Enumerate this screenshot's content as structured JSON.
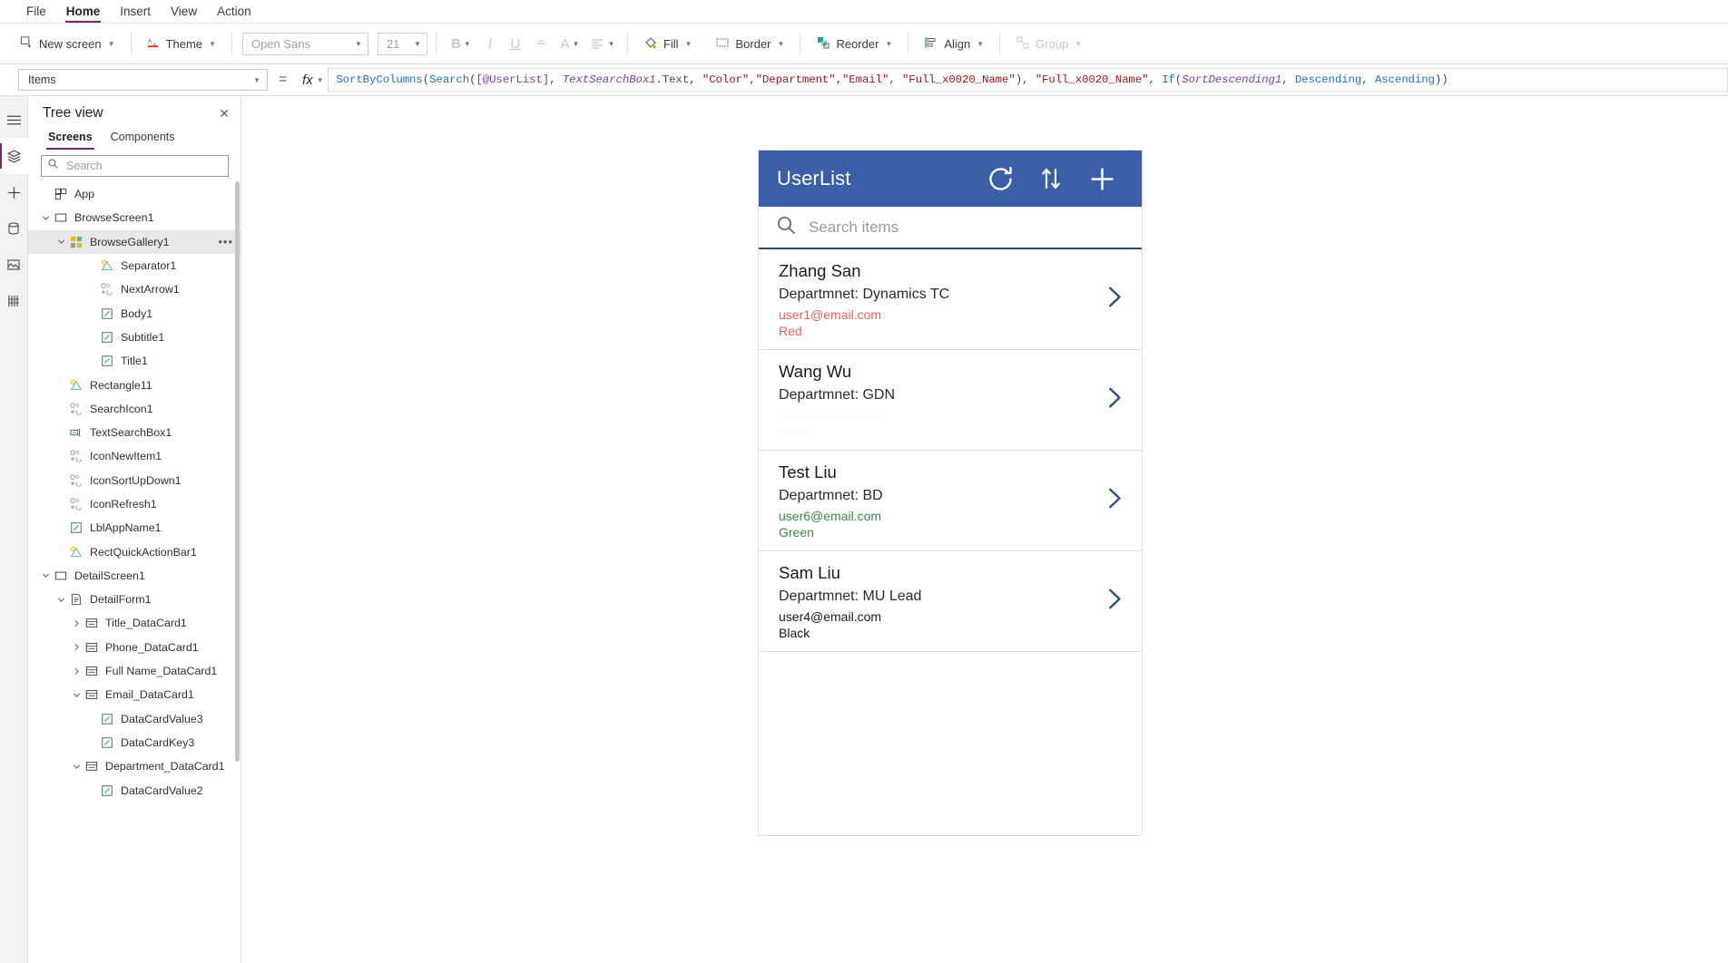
{
  "menubar": {
    "items": [
      {
        "label": "File",
        "active": false
      },
      {
        "label": "Home",
        "active": true
      },
      {
        "label": "Insert",
        "active": false
      },
      {
        "label": "View",
        "active": false
      },
      {
        "label": "Action",
        "active": false
      }
    ]
  },
  "ribbon": {
    "new_screen": "New screen",
    "theme": "Theme",
    "font_family": "Open Sans",
    "font_size": "21",
    "bold": "B",
    "italic": "I",
    "underline": "U",
    "strikethrough": "S",
    "font_color": "A",
    "align": "align",
    "fill": "Fill",
    "border": "Border",
    "reorder": "Reorder",
    "align_group": "Align",
    "group": "Group"
  },
  "formula_bar": {
    "property": "Items",
    "equals": "=",
    "fx": "fx",
    "formula_text": "SortByColumns(Search([@UserList], TextSearchBox1.Text, \"Color\",\"Department\",\"Email\", \"Full_x0020_Name\"), \"Full_x0020_Name\", If(SortDescending1, Descending, Ascending))",
    "tokens": [
      {
        "t": "SortByColumns",
        "c": "tk-fn"
      },
      {
        "t": "(",
        "c": "tk-op"
      },
      {
        "t": "Search",
        "c": "tk-fn"
      },
      {
        "t": "(",
        "c": "tk-op"
      },
      {
        "t": "[@UserList]",
        "c": "tk-tbl"
      },
      {
        "t": ", ",
        "c": "tk-op"
      },
      {
        "t": "TextSearchBox1",
        "c": "tk-id"
      },
      {
        "t": ".Text, ",
        "c": "tk-op"
      },
      {
        "t": "\"Color\"",
        "c": "tk-str"
      },
      {
        "t": ",",
        "c": "tk-op"
      },
      {
        "t": "\"Department\"",
        "c": "tk-str"
      },
      {
        "t": ",",
        "c": "tk-op"
      },
      {
        "t": "\"Email\"",
        "c": "tk-str"
      },
      {
        "t": ", ",
        "c": "tk-op"
      },
      {
        "t": "\"Full_x0020_Name\"",
        "c": "tk-str"
      },
      {
        "t": "), ",
        "c": "tk-op"
      },
      {
        "t": "\"Full_x0020_Name\"",
        "c": "tk-str"
      },
      {
        "t": ", ",
        "c": "tk-op"
      },
      {
        "t": "If",
        "c": "tk-fn"
      },
      {
        "t": "(",
        "c": "tk-op"
      },
      {
        "t": "SortDescending1",
        "c": "tk-id"
      },
      {
        "t": ", ",
        "c": "tk-op"
      },
      {
        "t": "Descending",
        "c": "tk-enum"
      },
      {
        "t": ", ",
        "c": "tk-op"
      },
      {
        "t": "Ascending",
        "c": "tk-enum"
      },
      {
        "t": "))",
        "c": "tk-op"
      }
    ]
  },
  "rail": {
    "items": [
      {
        "name": "hamburger-menu-icon",
        "selected": false
      },
      {
        "name": "tree-view-icon",
        "selected": true
      },
      {
        "name": "insert-plus-icon",
        "selected": false
      },
      {
        "name": "data-sources-icon",
        "selected": false
      },
      {
        "name": "media-icon",
        "selected": false
      },
      {
        "name": "variables-icon",
        "selected": false
      }
    ]
  },
  "tree_view": {
    "title": "Tree view",
    "close_label": "✕",
    "tabs": [
      {
        "label": "Screens",
        "active": true
      },
      {
        "label": "Components",
        "active": false
      }
    ],
    "search_placeholder": "Search",
    "search_value": "",
    "nodes": [
      {
        "label": "App",
        "indent": 0,
        "chev": "",
        "icon": "app-icon",
        "selected": false,
        "dots": false
      },
      {
        "label": "BrowseScreen1",
        "indent": 0,
        "chev": "v",
        "icon": "screen-icon",
        "selected": false,
        "dots": false
      },
      {
        "label": "BrowseGallery1",
        "indent": 1,
        "chev": "v",
        "icon": "gallery-icon",
        "selected": true,
        "dots": true
      },
      {
        "label": "Separator1",
        "indent": 3,
        "chev": "",
        "icon": "shape-icon",
        "selected": false,
        "dots": false
      },
      {
        "label": "NextArrow1",
        "indent": 3,
        "chev": "",
        "icon": "icon-icon",
        "selected": false,
        "dots": false
      },
      {
        "label": "Body1",
        "indent": 3,
        "chev": "",
        "icon": "label-icon",
        "selected": false,
        "dots": false
      },
      {
        "label": "Subtitle1",
        "indent": 3,
        "chev": "",
        "icon": "label-icon",
        "selected": false,
        "dots": false
      },
      {
        "label": "Title1",
        "indent": 3,
        "chev": "",
        "icon": "label-icon",
        "selected": false,
        "dots": false
      },
      {
        "label": "Rectangle11",
        "indent": 1,
        "chev": "",
        "icon": "shape-icon",
        "selected": false,
        "dots": false
      },
      {
        "label": "SearchIcon1",
        "indent": 1,
        "chev": "",
        "icon": "icon-icon",
        "selected": false,
        "dots": false
      },
      {
        "label": "TextSearchBox1",
        "indent": 1,
        "chev": "",
        "icon": "textinput-icon",
        "selected": false,
        "dots": false
      },
      {
        "label": "IconNewItem1",
        "indent": 1,
        "chev": "",
        "icon": "icon-icon",
        "selected": false,
        "dots": false
      },
      {
        "label": "IconSortUpDown1",
        "indent": 1,
        "chev": "",
        "icon": "icon-icon",
        "selected": false,
        "dots": false
      },
      {
        "label": "IconRefresh1",
        "indent": 1,
        "chev": "",
        "icon": "icon-icon",
        "selected": false,
        "dots": false
      },
      {
        "label": "LblAppName1",
        "indent": 1,
        "chev": "",
        "icon": "label-icon",
        "selected": false,
        "dots": false
      },
      {
        "label": "RectQuickActionBar1",
        "indent": 1,
        "chev": "",
        "icon": "shape-icon",
        "selected": false,
        "dots": false
      },
      {
        "label": "DetailScreen1",
        "indent": 0,
        "chev": "v",
        "icon": "screen-icon",
        "selected": false,
        "dots": false
      },
      {
        "label": "DetailForm1",
        "indent": 1,
        "chev": "v",
        "icon": "form-icon",
        "selected": false,
        "dots": false
      },
      {
        "label": "Title_DataCard1",
        "indent": 2,
        "chev": ">",
        "icon": "datacard-icon",
        "selected": false,
        "dots": false
      },
      {
        "label": "Phone_DataCard1",
        "indent": 2,
        "chev": ">",
        "icon": "datacard-icon",
        "selected": false,
        "dots": false
      },
      {
        "label": "Full Name_DataCard1",
        "indent": 2,
        "chev": ">",
        "icon": "datacard-icon",
        "selected": false,
        "dots": false
      },
      {
        "label": "Email_DataCard1",
        "indent": 2,
        "chev": "v",
        "icon": "datacard-icon",
        "selected": false,
        "dots": false
      },
      {
        "label": "DataCardValue3",
        "indent": 3,
        "chev": "",
        "icon": "label-icon",
        "selected": false,
        "dots": false
      },
      {
        "label": "DataCardKey3",
        "indent": 3,
        "chev": "",
        "icon": "label-icon",
        "selected": false,
        "dots": false
      },
      {
        "label": "Department_DataCard1",
        "indent": 2,
        "chev": "v",
        "icon": "datacard-icon",
        "selected": false,
        "dots": false
      },
      {
        "label": "DataCardValue2",
        "indent": 3,
        "chev": "",
        "icon": "label-icon",
        "selected": false,
        "dots": false
      }
    ]
  },
  "app_preview": {
    "header": {
      "title": "UserList",
      "icons": [
        {
          "name": "refresh-icon"
        },
        {
          "name": "sort-updown-icon"
        },
        {
          "name": "add-new-item-icon"
        }
      ],
      "background": "#3a5fa8"
    },
    "search": {
      "placeholder": "Search items",
      "value": "",
      "icon": "search-icon"
    },
    "gallery_items": [
      {
        "title": "Zhang San",
        "subtitle": "Departmnet: Dynamics TC",
        "email": "user1@email.com",
        "color_name": "Red",
        "color_hex": "#e8615a"
      },
      {
        "title": "Wang Wu",
        "subtitle": "Departmnet: GDN",
        "email": "user3@email.com",
        "color_name": "White",
        "color_hex": "#fcfcfc"
      },
      {
        "title": "Test Liu",
        "subtitle": "Departmnet: BD",
        "email": "user6@email.com",
        "color_name": "Green",
        "color_hex": "#3a8a48"
      },
      {
        "title": "Sam Liu",
        "subtitle": "Departmnet: MU Lead",
        "email": "user4@email.com",
        "color_name": "Black",
        "color_hex": "#1a1a1a"
      }
    ]
  }
}
